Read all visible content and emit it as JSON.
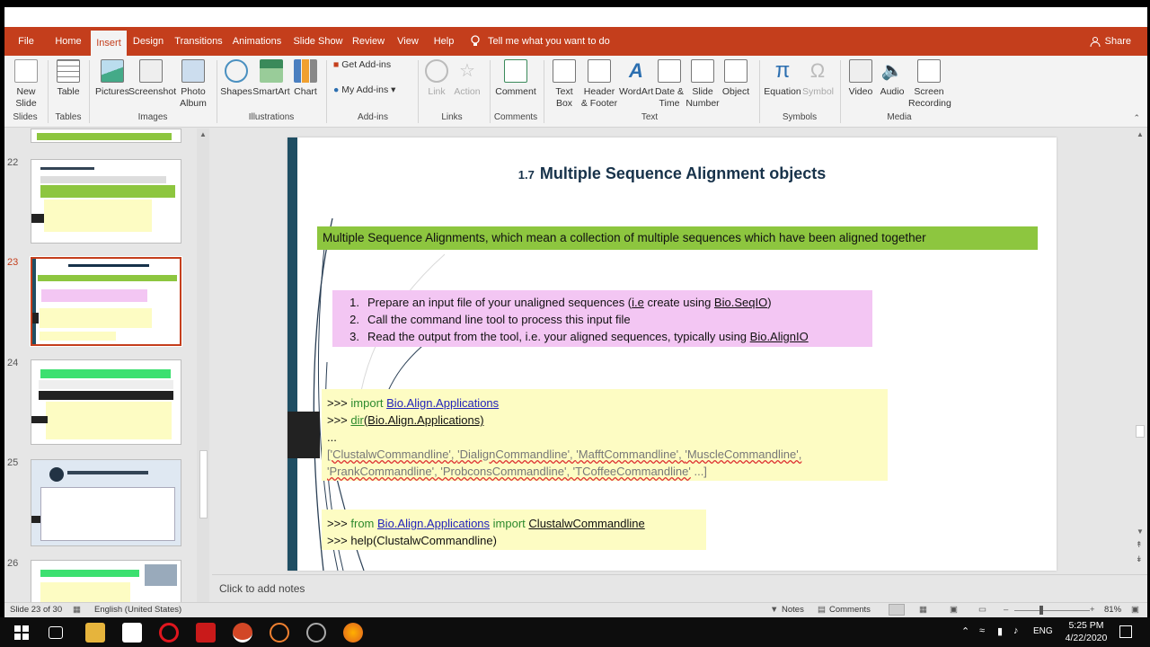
{
  "ribbon_tabs": [
    "File",
    "Home",
    "Insert",
    "Design",
    "Transitions",
    "Animations",
    "Slide Show",
    "Review",
    "View",
    "Help"
  ],
  "active_tab": "Insert",
  "tell_me": "Tell me what you want to do",
  "share": "Share",
  "ribbon": {
    "new_slide": "New Slide",
    "table": "Table",
    "pictures": "Pictures",
    "screenshot": "Screenshot",
    "photo_album": "Photo Album",
    "shapes": "Shapes",
    "smartart": "SmartArt",
    "chart": "Chart",
    "get_addins": "Get Add-ins",
    "my_addins": "My Add-ins",
    "link": "Link",
    "action": "Action",
    "comment": "Comment",
    "text_box": "Text Box",
    "header_footer": "Header & Footer",
    "wordart": "WordArt",
    "date_time": "Date & Time",
    "slide_number": "Slide Number",
    "object": "Object",
    "equation": "Equation",
    "symbol": "Symbol",
    "video": "Video",
    "audio": "Audio",
    "screen_recording": "Screen Recording",
    "groups": [
      "Slides",
      "Tables",
      "Images",
      "Illustrations",
      "Add-ins",
      "Links",
      "Comments",
      "Text",
      "Symbols",
      "Media"
    ]
  },
  "thumbnails": {
    "numbers": [
      "22",
      "23",
      "24",
      "25",
      "26"
    ],
    "selected": "23"
  },
  "slide": {
    "title_num": "1.7",
    "title": "Multiple Sequence Alignment objects",
    "green_bar": "Multiple Sequence Alignments, which  mean a collection of multiple sequences which have been aligned together",
    "steps": [
      {
        "n": "1.",
        "pre": "Prepare an input file of your unaligned sequences (",
        "u1": "i.e",
        "mid": " create using ",
        "u2": "Bio.SeqIO",
        "post": ")"
      },
      {
        "n": "2.",
        "pre": "Call the command line tool to process this input file",
        "u1": "",
        "mid": "",
        "u2": "",
        "post": ""
      },
      {
        "n": "3.",
        "pre": "Read the output from the tool, i.e. your aligned sequences, typically using ",
        "u1": "",
        "mid": "",
        "u2": "Bio.AlignIO",
        "post": ""
      }
    ],
    "code1": {
      "l1_prompt": ">>> ",
      "l1_kw": "import",
      "l1_mod": "Bio.Align.Applications",
      "l2_prompt": ">>> ",
      "l2_fn": "dir",
      "l2_arg": "(Bio.Align.Applications)",
      "l3": "...",
      "l4": [
        "['ClustalwCommandline', ",
        "'DialignCommandline', ",
        "'MafftCommandline', ",
        "'MuscleCommandline',"
      ],
      "l5": [
        "'PrankCommandline', ",
        "'ProbconsCommandline', ",
        "'TCoffeeCommandline'",
        " ...]"
      ]
    },
    "code2": {
      "prompt": ">>> ",
      "from": "from",
      "mod": "Bio.Align.Applications",
      "imp": "import",
      "cls": "ClustalwCommandline",
      "l2_prompt": ">>> ",
      "l2": "help(ClustalwCommandline)"
    }
  },
  "notes_placeholder": "Click to add notes",
  "status": {
    "slide_of": "Slide 23 of 30",
    "language": "English (United States)",
    "notes": "Notes",
    "comments": "Comments",
    "zoom": "81%"
  },
  "taskbar": {
    "time": "5:25 PM",
    "date": "4/22/2020",
    "lang": "ENG"
  },
  "colors": {
    "accent": "#c43e1c",
    "green_bar": "#8dc63f",
    "pink": "#f3c6f3",
    "code_bg": "#fdfcc3"
  }
}
